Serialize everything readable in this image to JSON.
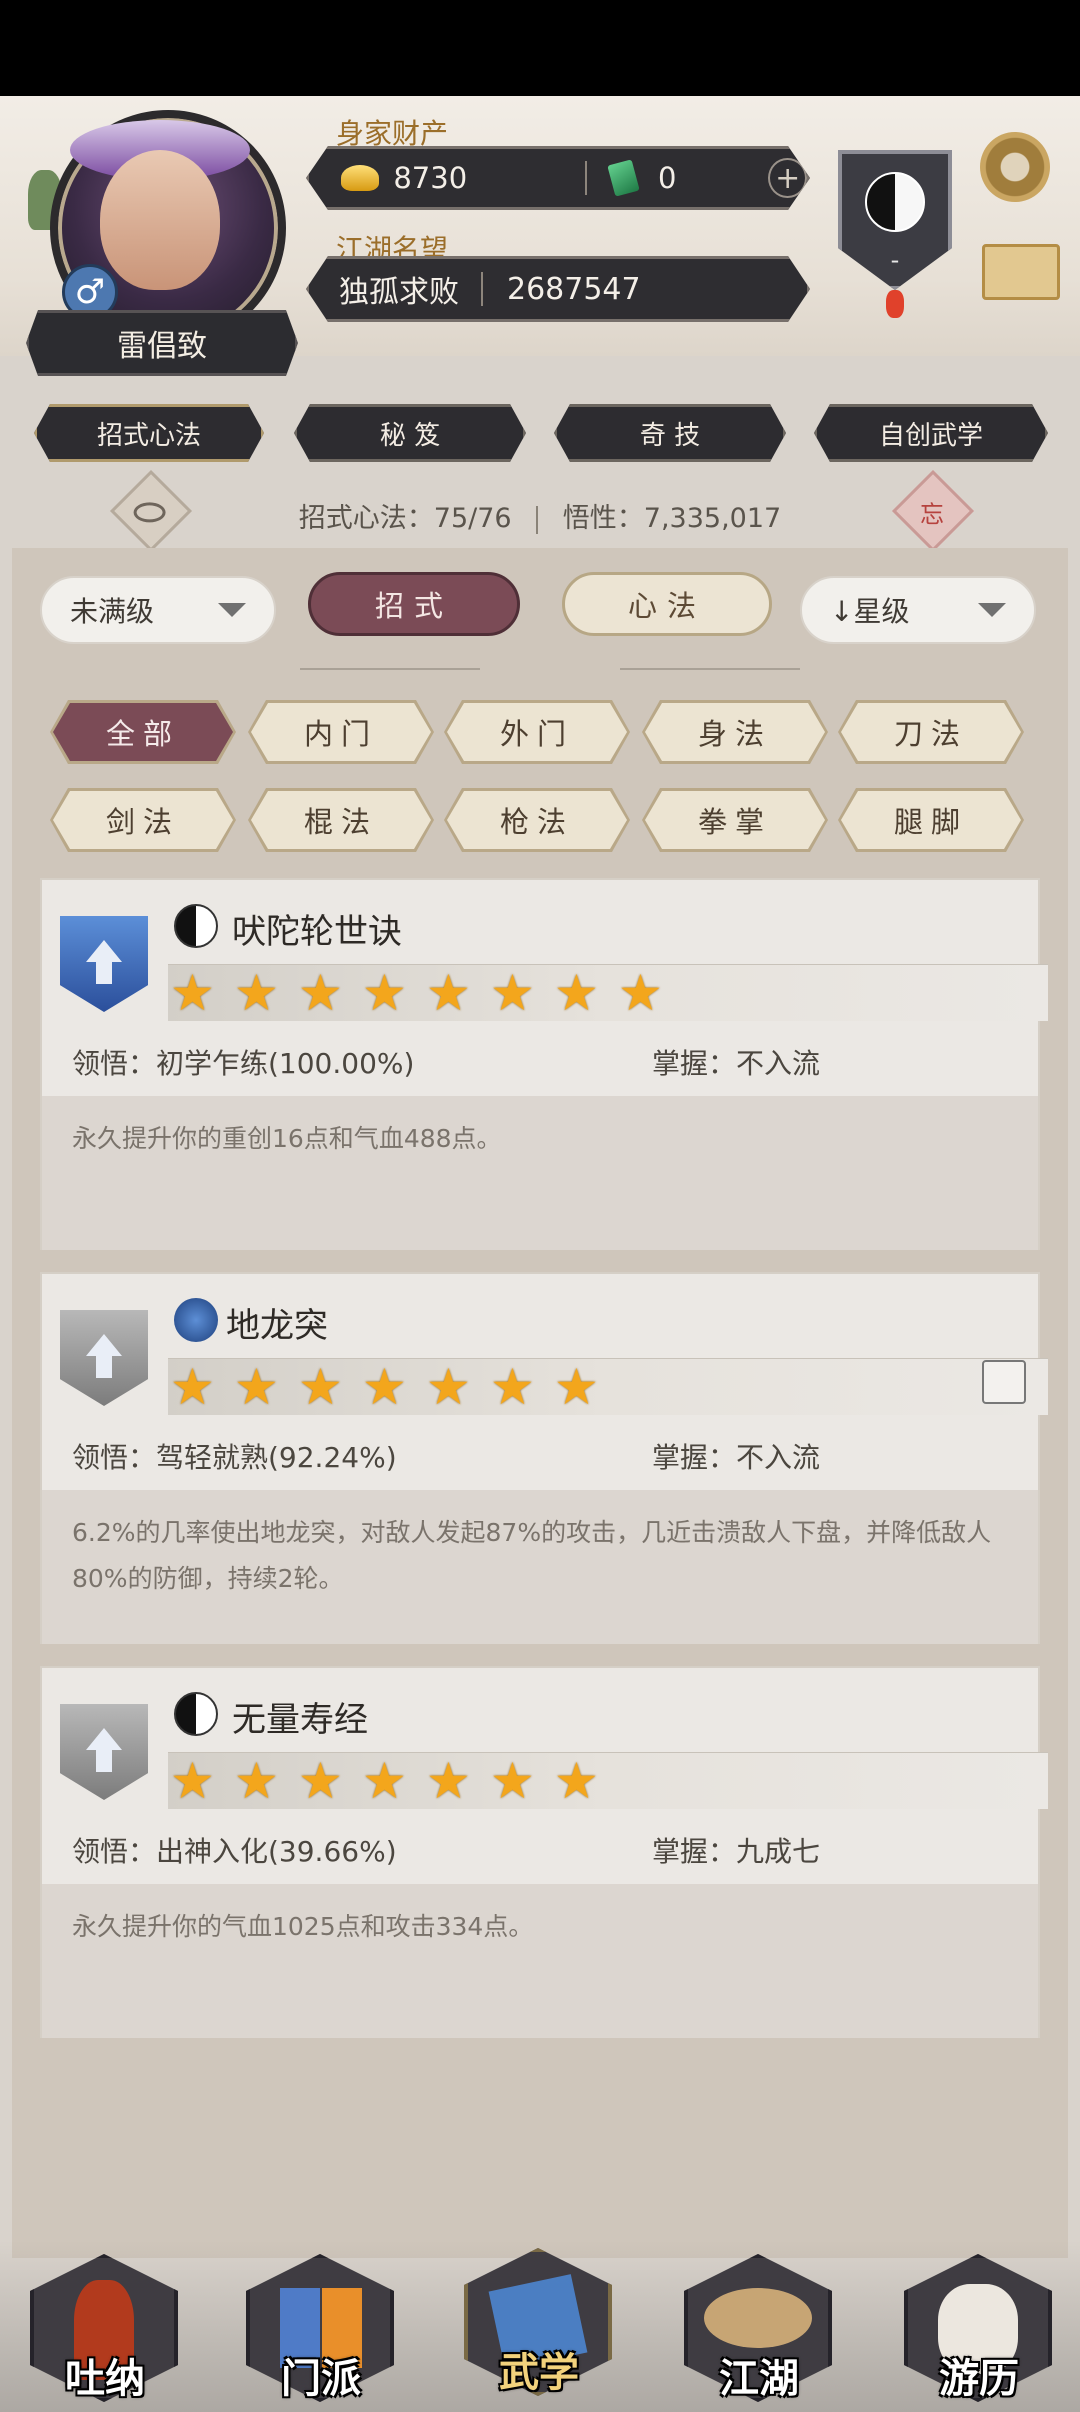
{
  "header": {
    "player_name": "雷倡致",
    "gender_symbol": "♂",
    "assets_label": "身家财产",
    "gold_amount": "8730",
    "jade_amount": "0",
    "plus_symbol": "+",
    "reputation_label": "江湖名望",
    "reputation_title": "独孤求败",
    "reputation_value": "2687547",
    "emblem_text": "-"
  },
  "top_tabs": [
    {
      "label": "招式心法"
    },
    {
      "label": "秘 笈"
    },
    {
      "label": "奇 技"
    },
    {
      "label": "自创武学"
    }
  ],
  "stats": {
    "moves_text": "招式心法：75/76",
    "insight_text": "悟性：7,335,017"
  },
  "forget_symbol": "忘",
  "filters_top": {
    "level_dropdown": "未满级",
    "tab_moves": "招式",
    "tab_heart": "心法",
    "sort_dropdown": "↓星级"
  },
  "categories": [
    "全部",
    "内门",
    "外门",
    "身法",
    "刀法",
    "剑法",
    "棍法",
    "枪法",
    "拳掌",
    "腿脚"
  ],
  "skills": [
    {
      "name": "吠陀轮世诀",
      "stars": 8,
      "insight": "领悟：初学乍练(100.00%)",
      "mastery": "掌握：不入流",
      "description": "永久提升你的重创16点和气血488点。"
    },
    {
      "name": "地龙突",
      "stars": 7,
      "insight": "领悟：驾轻就熟(92.24%)",
      "mastery": "掌握：不入流",
      "description": "6.2%的几率使出地龙突，对敌人发起87%的攻击，几近击溃敌人下盘，并降低敌人80%的防御，持续2轮。"
    },
    {
      "name": "无量寿经",
      "stars": 7,
      "insight": "领悟：出神入化(39.66%)",
      "mastery": "掌握：九成七",
      "description": "永久提升你的气血1025点和攻击334点。"
    }
  ],
  "bottom_nav": [
    {
      "label": "吐纳"
    },
    {
      "label": "门派"
    },
    {
      "label": "武学"
    },
    {
      "label": "江湖"
    },
    {
      "label": "游历"
    }
  ]
}
